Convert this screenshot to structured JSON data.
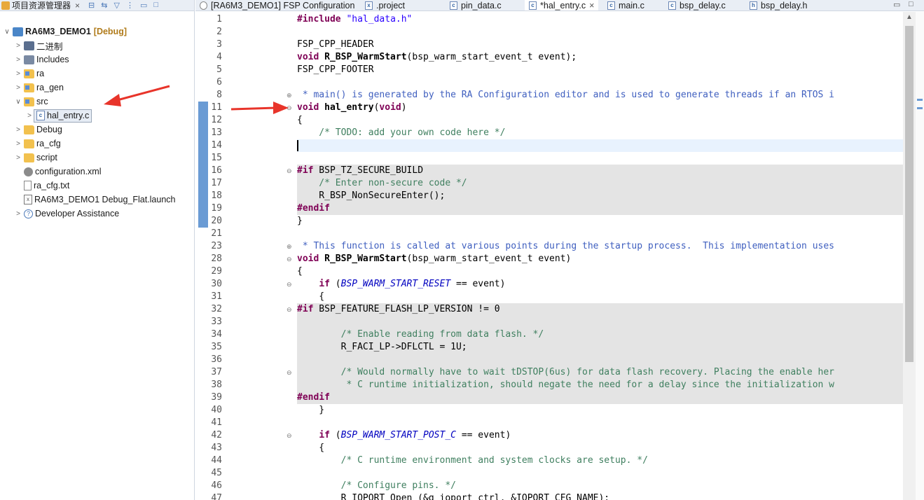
{
  "explorer": {
    "tab_label": "项目资源管理器",
    "close_glyph": "×",
    "items": [
      {
        "label": "RA6M3_DEMO1",
        "tag": "[Debug]",
        "icon": "project-icon",
        "caret": "∨"
      },
      {
        "label": "二进制",
        "icon": "binaries-icon",
        "caret": ">"
      },
      {
        "label": "Includes",
        "icon": "includes-icon",
        "caret": ">"
      },
      {
        "label": "ra",
        "icon": "folder-icon",
        "caret": ">"
      },
      {
        "label": "ra_gen",
        "icon": "folder-icon",
        "caret": ">"
      },
      {
        "label": "src",
        "icon": "folder-icon",
        "caret": "∨"
      },
      {
        "label": "hal_entry.c",
        "icon": "c-file-icon",
        "caret": ">"
      },
      {
        "label": "Debug",
        "icon": "folder-icon",
        "caret": ">"
      },
      {
        "label": "ra_cfg",
        "icon": "folder-icon",
        "caret": ">"
      },
      {
        "label": "script",
        "icon": "folder-icon",
        "caret": ">"
      },
      {
        "label": "configuration.xml",
        "icon": "configuration-icon",
        "caret": ""
      },
      {
        "label": "ra_cfg.txt",
        "icon": "text-file-icon",
        "caret": ""
      },
      {
        "label": "RA6M3_DEMO1 Debug_Flat.launch",
        "icon": "launch-file-icon",
        "caret": ""
      },
      {
        "label": "Developer Assistance",
        "icon": "help-icon",
        "caret": ">"
      }
    ]
  },
  "editor_tabs": [
    {
      "label": "[RA6M3_DEMO1] FSP Configuration",
      "icon": "fsp-config-icon"
    },
    {
      "label": ".project",
      "icon": "xml-file-icon"
    },
    {
      "label": "pin_data.c",
      "icon": "c-file-icon"
    },
    {
      "label": "*hal_entry.c",
      "icon": "c-file-icon",
      "active": true
    },
    {
      "label": "main.c",
      "icon": "c-file-icon"
    },
    {
      "label": "bsp_delay.c",
      "icon": "c-file-icon"
    },
    {
      "label": "bsp_delay.h",
      "icon": "h-file-icon"
    }
  ],
  "line_numbers": [
    "1",
    "2",
    "3",
    "4",
    "5",
    "6",
    "8",
    "11",
    "12",
    "13",
    "14",
    "15",
    "16",
    "17",
    "18",
    "19",
    "20",
    "21",
    "23",
    "28",
    "29",
    "30",
    "31",
    "32",
    "33",
    "34",
    "35",
    "36",
    "37",
    "38",
    "39",
    "40",
    "41",
    "42",
    "43",
    "44",
    "45",
    "46",
    "47"
  ],
  "code": {
    "l1_inc": "#include",
    "l1_str": " \"hal_data.h\"",
    "l3": "FSP_CPP_HEADER",
    "l4_kw": "void",
    "l4_fn": " R_BSP_WarmStart",
    "l4_rest": "(bsp_warm_start_event_t event);",
    "l5": "FSP_CPP_FOOTER",
    "l8": " * main() is generated by the RA Configuration editor and is used to generate threads if an RTOS i",
    "l11_kw": "void",
    "l11_fn": " hal_entry",
    "l11_p1": "(",
    "l11_kw2": "void",
    "l11_p2": ")",
    "l12": "{",
    "l13": "    /* TODO: add your own code here */",
    "l16_kw": "#if",
    "l16_rest": " BSP_TZ_SECURE_BUILD",
    "l17": "    /* Enter non-secure code */",
    "l18": "    R_BSP_NonSecureEnter();",
    "l19": "#endif",
    "l20": "}",
    "l23": " * This function is called at various points during the startup process.  This implementation uses",
    "l28_kw": "void",
    "l28_fn": " R_BSP_WarmStart",
    "l28_rest": "(bsp_warm_start_event_t event)",
    "l29": "{",
    "l30_pre": "    ",
    "l30_kw": "if",
    "l30_p": " (",
    "l30_mac": "BSP_WARM_START_RESET",
    "l30_rest": " == event)",
    "l31": "    {",
    "l32_kw": "#if",
    "l32_rest": " BSP_FEATURE_FLASH_LP_VERSION != 0",
    "l34": "        /* Enable reading from data flash. */",
    "l35": "        R_FACI_LP->DFLCTL = 1U;",
    "l37": "        /* Would normally have to wait tDSTOP(6us) for data flash recovery. Placing the enable her",
    "l38": "         * C runtime initialization, should negate the need for a delay since the initialization w",
    "l39": "#endif",
    "l40": "    }",
    "l42_pre": "    ",
    "l42_kw": "if",
    "l42_p": " (",
    "l42_mac": "BSP_WARM_START_POST_C",
    "l42_rest": " == event)",
    "l43": "    {",
    "l44": "        /* C runtime environment and system clocks are setup. */",
    "l46": "        /* Configure pins. */",
    "l47": "        R_IOPORT_Open (&g_ioport_ctrl, &IOPORT_CFG_NAME);"
  },
  "colors": {
    "keyword": "#7f0055",
    "comment": "#3f7f5f",
    "javadoc": "#3f5fbf",
    "string": "#2a00ff",
    "macro": "#0000c0",
    "annotation_arrow": "#e8342a",
    "change_bar": "#6a9bd4"
  }
}
